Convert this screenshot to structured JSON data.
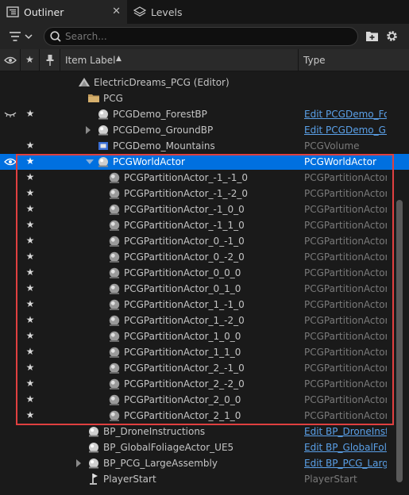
{
  "tabs": [
    {
      "label": "Outliner",
      "close": "✕"
    },
    {
      "label": "Levels"
    }
  ],
  "toolbar": {
    "search_placeholder": "Search..."
  },
  "header": {
    "item_label": "Item Label",
    "type": "Type",
    "sort": "▲"
  },
  "rows": [
    {
      "label": "ElectricDreams_PCG (Editor)",
      "type": "",
      "icon": "level-icon",
      "indent": 98
    },
    {
      "label": "PCG",
      "type": "",
      "icon": "folder-icon",
      "indent": 110
    },
    {
      "label": "PCGDemo_ForestBP",
      "type": "Edit PCGDemo_Fore",
      "type_link": true,
      "icon": "actor-icon",
      "indent": 122,
      "star": true,
      "eye_closed": true
    },
    {
      "label": "PCGDemo_GroundBP",
      "type": "Edit PCGDemo_Gro",
      "type_link": true,
      "icon": "actor-icon",
      "indent": 122,
      "expand": "right"
    },
    {
      "label": "PCGDemo_Mountains",
      "type": "PCGVolume",
      "icon": "volume-icon",
      "indent": 122,
      "star": true
    },
    {
      "label": "PCGWorldActor",
      "type": "PCGWorldActor",
      "icon": "actor-icon",
      "indent": 122,
      "star": true,
      "eye": true,
      "selected": true,
      "expand": "down"
    },
    {
      "label": "PCGPartitionActor_-1_-1_0",
      "type": "PCGPartitionActor",
      "icon": "sphere-icon",
      "indent": 136,
      "star": true
    },
    {
      "label": "PCGPartitionActor_-1_-2_0",
      "type": "PCGPartitionActor",
      "icon": "sphere-icon",
      "indent": 136,
      "star": true
    },
    {
      "label": "PCGPartitionActor_-1_0_0",
      "type": "PCGPartitionActor",
      "icon": "sphere-icon",
      "indent": 136,
      "star": true
    },
    {
      "label": "PCGPartitionActor_-1_1_0",
      "type": "PCGPartitionActor",
      "icon": "sphere-icon",
      "indent": 136,
      "star": true
    },
    {
      "label": "PCGPartitionActor_0_-1_0",
      "type": "PCGPartitionActor",
      "icon": "sphere-icon",
      "indent": 136,
      "star": true
    },
    {
      "label": "PCGPartitionActor_0_-2_0",
      "type": "PCGPartitionActor",
      "icon": "sphere-icon",
      "indent": 136,
      "star": true
    },
    {
      "label": "PCGPartitionActor_0_0_0",
      "type": "PCGPartitionActor",
      "icon": "sphere-icon",
      "indent": 136,
      "star": true
    },
    {
      "label": "PCGPartitionActor_0_1_0",
      "type": "PCGPartitionActor",
      "icon": "sphere-icon",
      "indent": 136,
      "star": true
    },
    {
      "label": "PCGPartitionActor_1_-1_0",
      "type": "PCGPartitionActor",
      "icon": "sphere-icon",
      "indent": 136,
      "star": true
    },
    {
      "label": "PCGPartitionActor_1_-2_0",
      "type": "PCGPartitionActor",
      "icon": "sphere-icon",
      "indent": 136,
      "star": true
    },
    {
      "label": "PCGPartitionActor_1_0_0",
      "type": "PCGPartitionActor",
      "icon": "sphere-icon",
      "indent": 136,
      "star": true
    },
    {
      "label": "PCGPartitionActor_1_1_0",
      "type": "PCGPartitionActor",
      "icon": "sphere-icon",
      "indent": 136,
      "star": true
    },
    {
      "label": "PCGPartitionActor_2_-1_0",
      "type": "PCGPartitionActor",
      "icon": "sphere-icon",
      "indent": 136,
      "star": true
    },
    {
      "label": "PCGPartitionActor_2_-2_0",
      "type": "PCGPartitionActor",
      "icon": "sphere-icon",
      "indent": 136,
      "star": true
    },
    {
      "label": "PCGPartitionActor_2_0_0",
      "type": "PCGPartitionActor",
      "icon": "sphere-icon",
      "indent": 136,
      "star": true
    },
    {
      "label": "PCGPartitionActor_2_1_0",
      "type": "PCGPartitionActor",
      "icon": "sphere-icon",
      "indent": 136,
      "star": true
    },
    {
      "label": "BP_DroneInstructions",
      "type": "Edit BP_DroneInstru",
      "type_link": true,
      "icon": "actor-icon",
      "indent": 110
    },
    {
      "label": "BP_GlobalFoliageActor_UE5",
      "type": "Edit BP_GlobalFolia",
      "type_link": true,
      "icon": "actor-icon",
      "indent": 110
    },
    {
      "label": "BP_PCG_LargeAssembly",
      "type": "Edit BP_PCG_Large",
      "type_link": true,
      "icon": "actor-icon",
      "indent": 110,
      "expand": "right"
    },
    {
      "label": "PlayerStart",
      "type": "PlayerStart",
      "icon": "player-start-icon",
      "indent": 110
    }
  ]
}
